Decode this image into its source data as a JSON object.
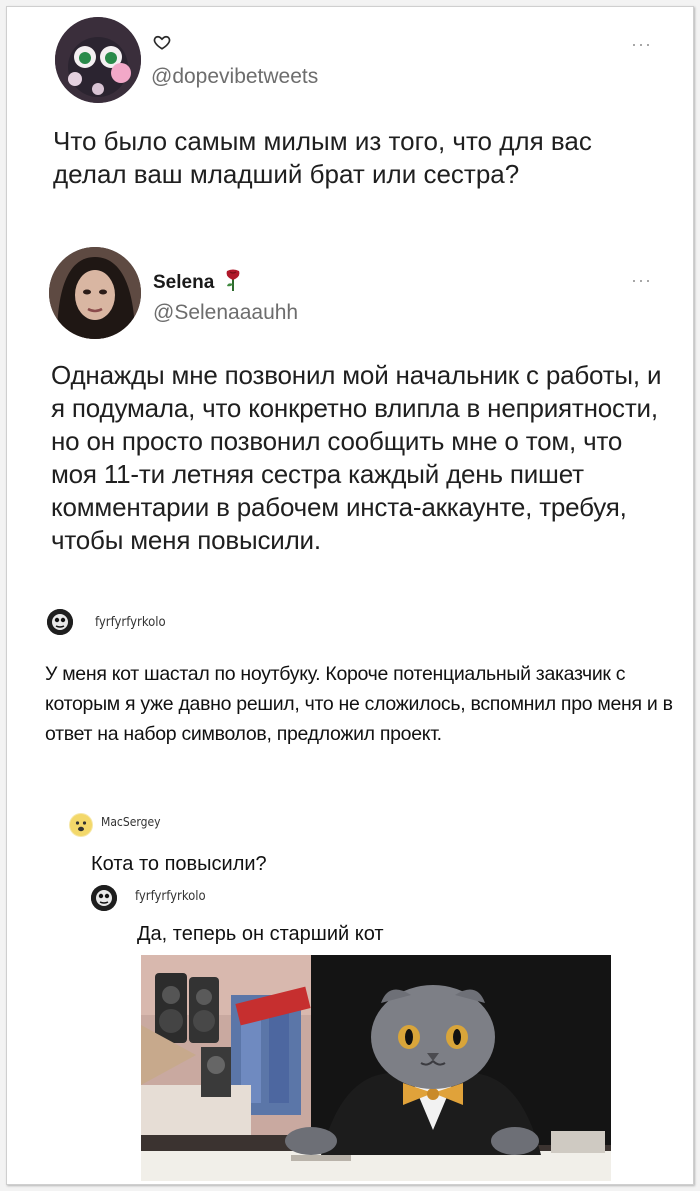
{
  "tweet1": {
    "handle": "@dopevibetweets",
    "text": "Что было самым милым из того, что для вас делал ваш младший брат или сестра?"
  },
  "tweet2": {
    "name": "Selena",
    "handle": "@Selenaaauhh",
    "text": "Однажды мне позвонил мой начальник с работы, и я подумала, что конкретно влипла в неприятности, но он просто позвонил сообщить мне о том, что моя 11-ти летняя сестра каждый день пишет комментарии в рабочем инста-аккаунте, требуя, чтобы меня повысили."
  },
  "comments": [
    {
      "user": "fyrfyrfyrkolo",
      "text": "У меня кот шастал по ноутбуку. Короче потенциальный заказчик с которым я уже давно решил, что не сложилось, вспомнил про меня и в ответ на набор символов, предложил проект."
    },
    {
      "user": "MacSergey",
      "text": "Кота то повысили?"
    },
    {
      "user": "fyrfyrfyrkolo",
      "text": "Да, теперь он старший кот"
    }
  ],
  "icons": {
    "heart": "heart-icon",
    "more": "more-icon",
    "rose": "rose-emoji-icon"
  },
  "colors": {
    "bow": "#e0a23a",
    "rose": "#b0182a"
  }
}
